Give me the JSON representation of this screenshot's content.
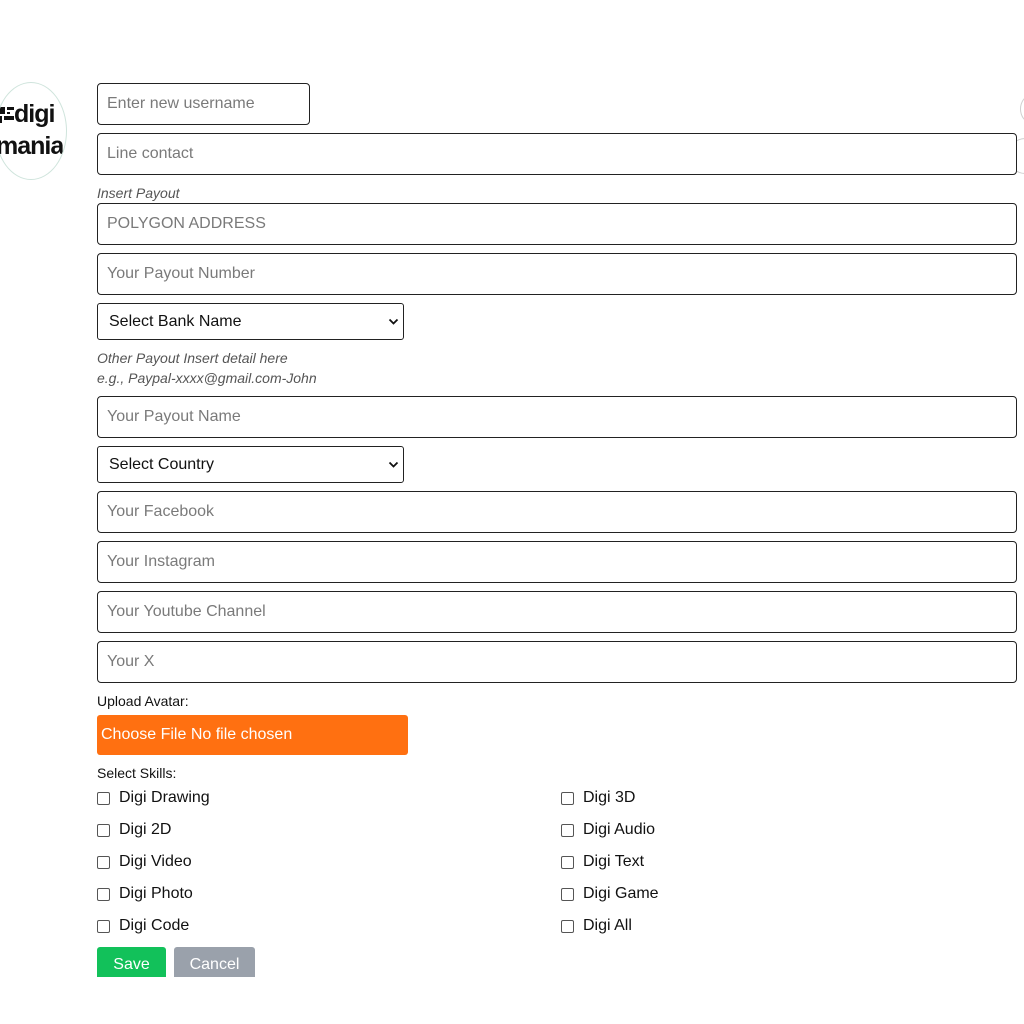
{
  "logo": {
    "line1": "digi",
    "line2": "mania"
  },
  "fields": {
    "username_placeholder": "Enter new username",
    "line_placeholder": "Line contact",
    "polygon_placeholder": "POLYGON ADDRESS",
    "payout_number_placeholder": "Your Payout Number",
    "payout_name_placeholder": "Your Payout Name",
    "facebook_placeholder": "Your Facebook",
    "instagram_placeholder": "Your Instagram",
    "youtube_placeholder": "Your Youtube Channel",
    "x_placeholder": "Your X"
  },
  "hints": {
    "insert_payout": "Insert Payout",
    "other_payout_line1": "Other Payout Insert detail here",
    "other_payout_line2": "e.g., Paypal-xxxx@gmail.com-John"
  },
  "selects": {
    "bank_name": "Select Bank Name",
    "country": "Select Country"
  },
  "upload": {
    "label": "Upload Avatar:",
    "button": "Choose File No file chosen"
  },
  "skills": {
    "label": "Select Skills:",
    "left": [
      "Digi Drawing",
      "Digi 2D",
      "Digi Video",
      "Digi Photo",
      "Digi Code"
    ],
    "right": [
      "Digi 3D",
      "Digi Audio",
      "Digi Text",
      "Digi Game",
      "Digi All"
    ]
  },
  "actions": {
    "save": "Save",
    "cancel": "Cancel"
  },
  "colors": {
    "upload_button": "#ff7011",
    "save_button": "#12c15a",
    "cancel_button": "#9aa1ab"
  }
}
